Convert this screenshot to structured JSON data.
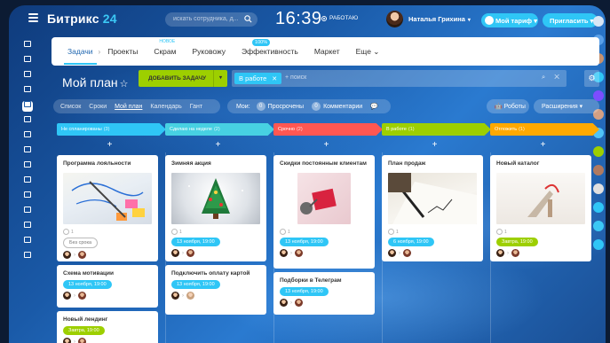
{
  "topbar": {
    "logo_main": "Битрикс",
    "logo_num": "24",
    "search_placeholder": "искать сотрудника, д...",
    "clock": "16:39",
    "work_status": "РАБОТАЮ",
    "user_name": "Наталья Грихина",
    "tariff_label": "Мой тариф",
    "invite_label": "Пригласить"
  },
  "tabs": [
    {
      "label": "Задачи",
      "active": true
    },
    {
      "label": "Проекты"
    },
    {
      "label": "Скрам",
      "sup": "НОВОЕ"
    },
    {
      "label": "Руковожу"
    },
    {
      "label": "Эффективность",
      "badge": "100%"
    },
    {
      "label": "Маркет"
    },
    {
      "label": "Еще"
    }
  ],
  "page": {
    "title": "Мой план",
    "add_task": "ДОБАВИТЬ ЗАДАЧУ",
    "filter_tag": "В работе",
    "filter_placeholder": "+ поиск"
  },
  "views": [
    "Список",
    "Сроки",
    "Мой план",
    "Календарь",
    "Гант"
  ],
  "counters": {
    "label": "Мои:",
    "overdue_count": "0",
    "overdue_label": "Просрочены",
    "comments_count": "0",
    "comments_label": "Комментарии"
  },
  "robots_label": "Роботы",
  "extensions_label": "Расширения",
  "columns": [
    {
      "title": "Не спланированы",
      "count": "(3)",
      "color": "#2fc6f6"
    },
    {
      "title": "Сделаю на неделе",
      "count": "(2)",
      "color": "#47d1e2"
    },
    {
      "title": "Срочно",
      "count": "(2)",
      "color": "#ff5752"
    },
    {
      "title": "В работе",
      "count": "(1)",
      "color": "#9dcf00"
    },
    {
      "title": "Отложить",
      "count": "(1)",
      "color": "#ffa900"
    }
  ],
  "cards": {
    "c1": {
      "title": "Программа лояльности",
      "meta": "1",
      "deadline": "Без срока"
    },
    "c2": {
      "title": "Схема мотивации",
      "deadline": "13 ноября, 19:00"
    },
    "c3": {
      "title": "Новый лендинг",
      "deadline": "Завтра, 19:00"
    },
    "c4": {
      "title": "Зимняя акция",
      "meta": "1",
      "deadline": "13 ноября, 19:00"
    },
    "c5": {
      "title": "Подключить оплату картой",
      "deadline": "13 ноября, 19:00"
    },
    "c6": {
      "title": "Скидки постоянным клиентам",
      "meta": "1",
      "deadline": "13 ноября, 19:00"
    },
    "c7": {
      "title": "Подборки в Телеграм",
      "deadline": "13 ноября, 19:00"
    },
    "c8": {
      "title": "План продаж",
      "meta": "1",
      "deadline": "6 ноября, 19:00"
    },
    "c9": {
      "title": "Новый каталог",
      "meta": "1",
      "deadline": "Завтра, 19:00"
    }
  },
  "colors": {
    "accent": "#2fc6f6",
    "green": "#9dcf00",
    "red": "#ff5752",
    "orange": "#ffa900"
  }
}
